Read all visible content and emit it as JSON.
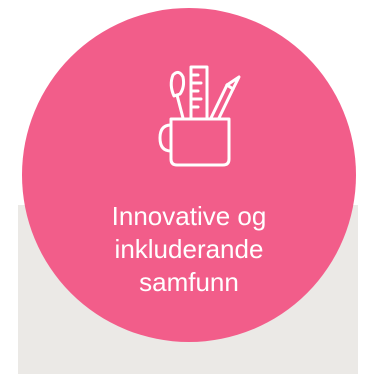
{
  "card": {
    "title_lines": [
      "Innovative og",
      "inkluderande",
      "samfunn"
    ],
    "icon": "pencil-cup-icon",
    "background_color": "#f25d8a",
    "text_color": "#ffffff",
    "panel_color": "#ebe9e6"
  }
}
